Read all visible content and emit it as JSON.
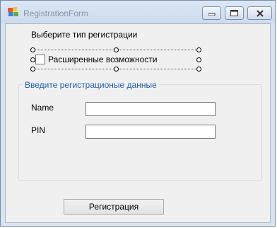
{
  "window": {
    "title": "RegistrationForm",
    "controls": {
      "minimize_icon": "minimize-icon",
      "maximize_icon": "maximize-icon",
      "close_icon": "close-icon"
    }
  },
  "form": {
    "registration_type_label": "Выберите тип регистрации",
    "advanced_checkbox": {
      "label": "Расширенные возможности",
      "checked": false
    },
    "group": {
      "title": "Введите регистрационые данные",
      "name_label": "Name",
      "name_value": "",
      "pin_label": "PIN",
      "pin_value": ""
    },
    "register_button": "Регистрация"
  },
  "colors": {
    "group_title": "#1f5fa9",
    "title_text": "#8794a6"
  }
}
